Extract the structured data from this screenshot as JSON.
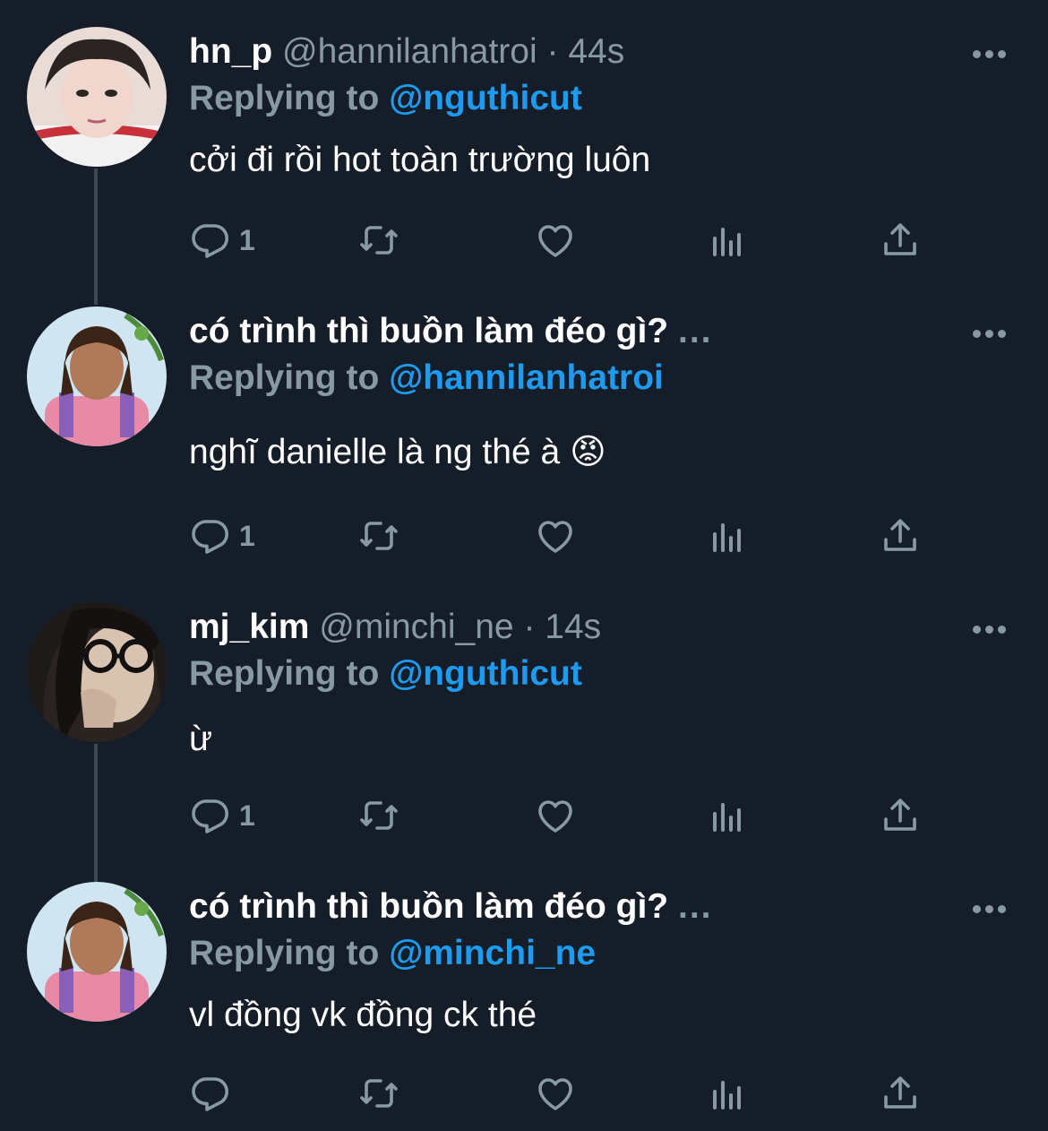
{
  "tweets": [
    {
      "name": "hn_p",
      "handle": "@hannilanhatroi",
      "separator": "·",
      "time": "44s",
      "replying_label": "Replying to",
      "replying_to": "@nguthicut",
      "text": "cởi đi rồi hot toàn trường luôn",
      "reply_count": "1"
    },
    {
      "name": "có trình thì buồn làm đéo gì?",
      "name_overflow": "...",
      "replying_label": "Replying to",
      "replying_to": "@hannilanhatroi",
      "text": "nghĩ danielle là ng thé à 😡",
      "reply_count": "1"
    },
    {
      "name": "mj_kim",
      "handle": "@minchi_ne",
      "separator": "·",
      "time": "14s",
      "replying_label": "Replying to",
      "replying_to": "@nguthicut",
      "text": "ừ",
      "reply_count": "1"
    },
    {
      "name": "có trình thì buồn làm đéo gì?",
      "name_overflow": "...",
      "replying_label": "Replying to",
      "replying_to": "@minchi_ne",
      "text": "vl đồng vk đồng ck thé",
      "reply_count": ""
    }
  ],
  "colors": {
    "background": "#151d28",
    "muted": "#8899a6",
    "link": "#1d9bf0",
    "thread_line": "#3c4754"
  },
  "icons": [
    "reply-icon",
    "retweet-icon",
    "like-icon",
    "views-icon",
    "share-icon",
    "more-icon"
  ]
}
